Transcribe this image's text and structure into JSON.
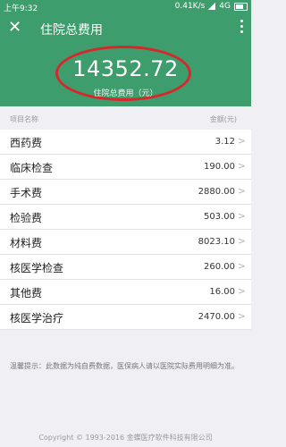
{
  "status_bar": {
    "time": "上午9:32",
    "speed": "0.41K/s",
    "network": "4G"
  },
  "header": {
    "title": "住院总费用",
    "close_icon": "close-icon",
    "more_icon": "more-vertical-icon"
  },
  "summary": {
    "amount": "14352.72",
    "label": "住院总费用（元）"
  },
  "table": {
    "headers": {
      "name": "项目名称",
      "amount": "金额(元)"
    },
    "rows": [
      {
        "name": "西药费",
        "amount": "3.12"
      },
      {
        "name": "临床检查",
        "amount": "190.00"
      },
      {
        "name": "手术费",
        "amount": "2880.00"
      },
      {
        "name": "检验费",
        "amount": "503.00"
      },
      {
        "name": "材料费",
        "amount": "8023.10"
      },
      {
        "name": "核医学检查",
        "amount": "260.00"
      },
      {
        "name": "其他费",
        "amount": "16.00"
      },
      {
        "name": "核医学治疗",
        "amount": "2470.00"
      }
    ]
  },
  "tip": "温馨提示：此数据为纯自费数据，医保病人请以医院实际费用明细为准。",
  "copyright": "Copyright © 1993-2016 金蝶医疗软件科技有限公司",
  "colors": {
    "primary": "#3e9d6c",
    "highlight": "#d9262c"
  }
}
